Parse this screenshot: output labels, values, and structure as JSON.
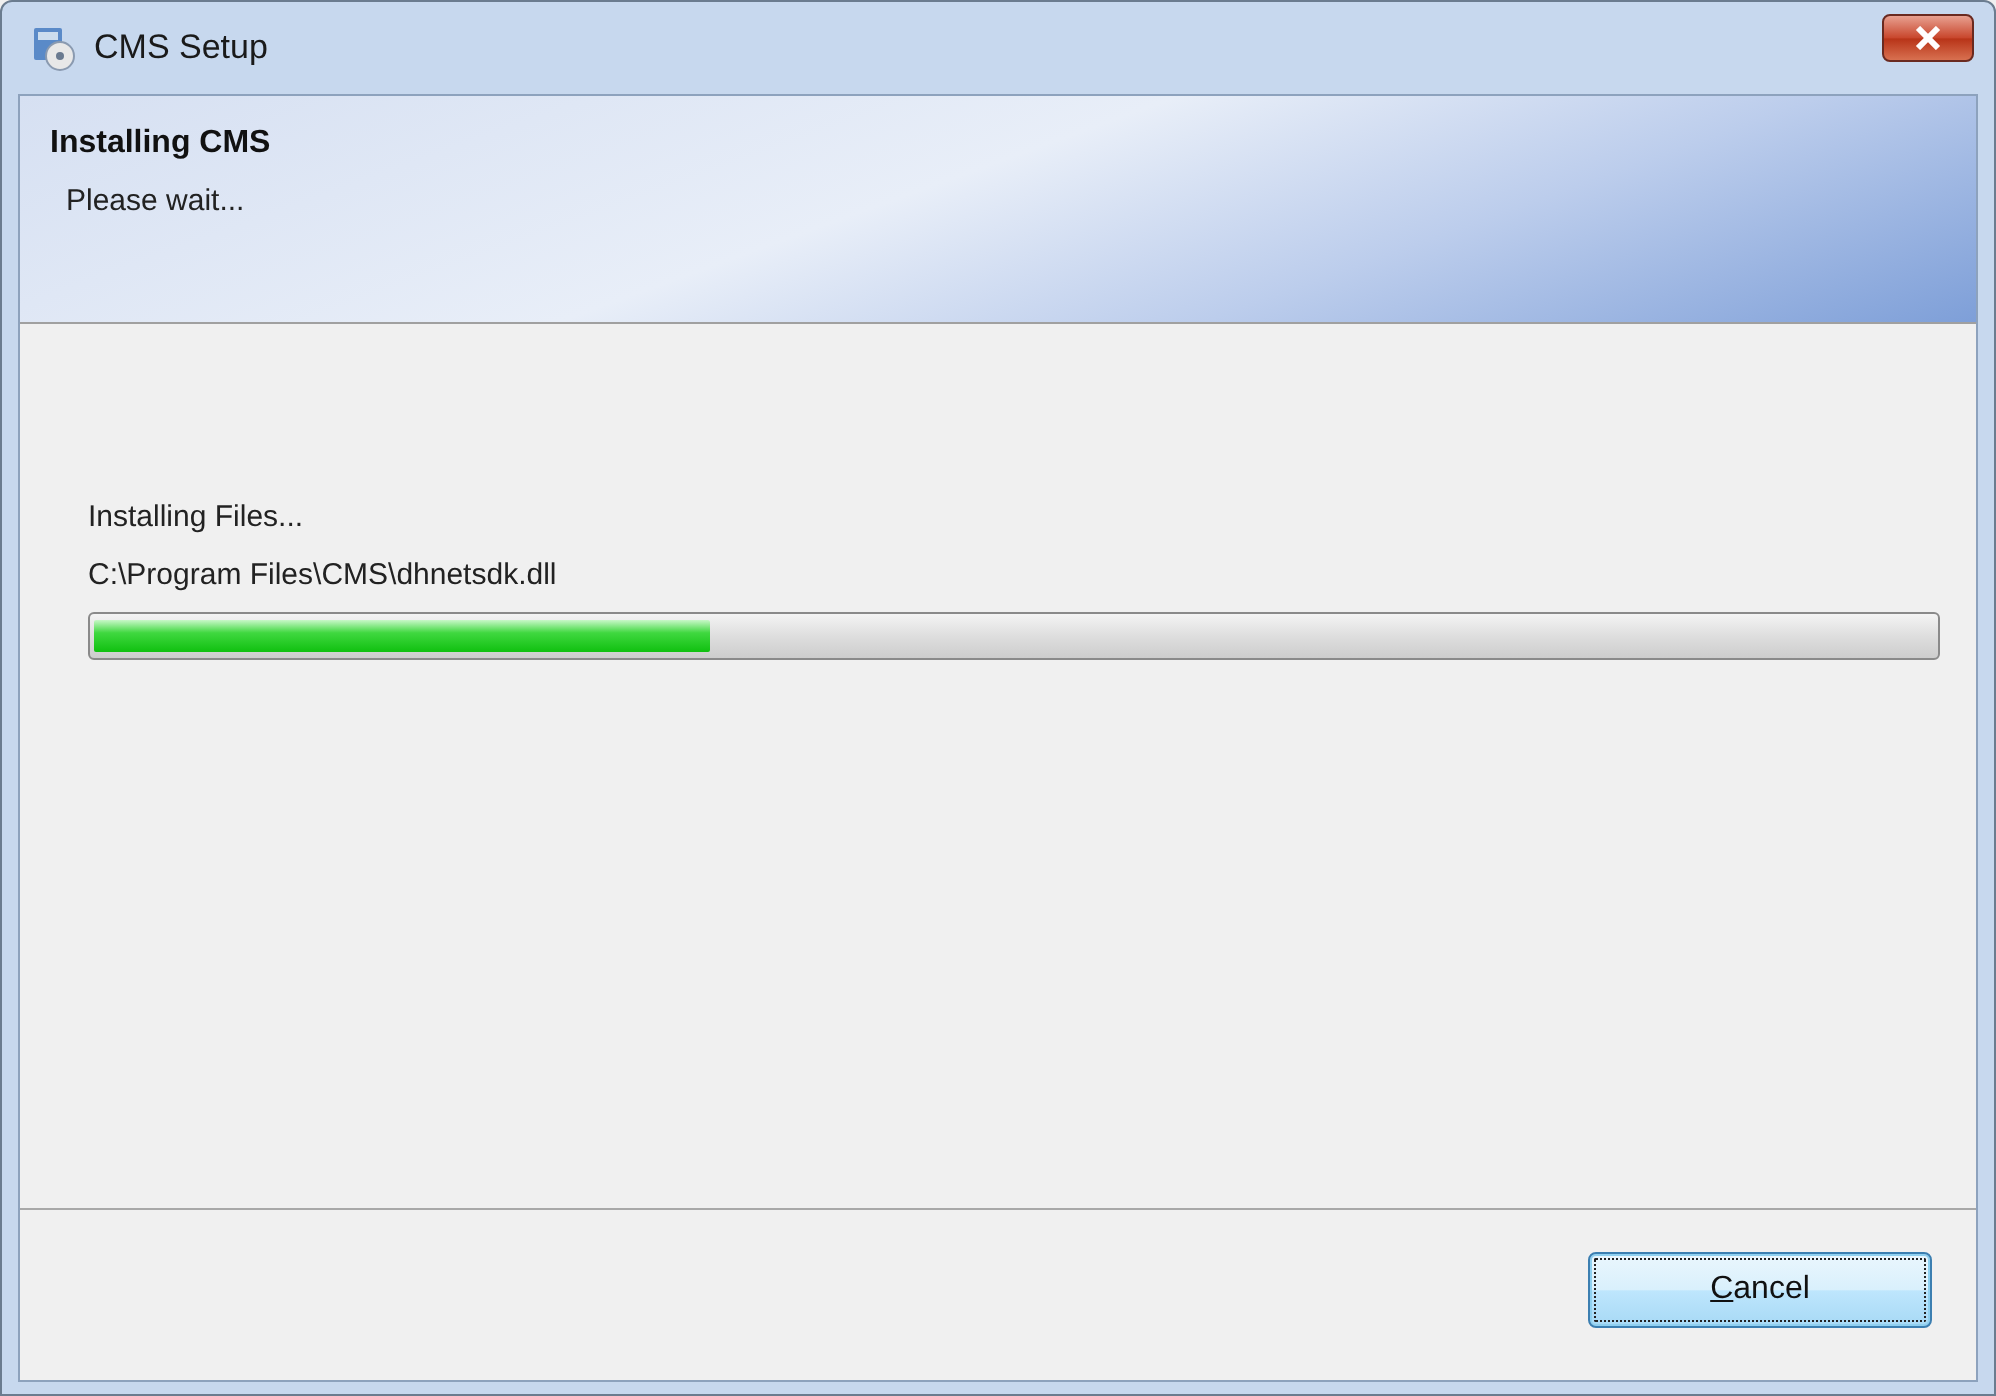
{
  "window": {
    "title": "CMS Setup"
  },
  "header": {
    "title": "Installing CMS",
    "subtitle": "Please wait..."
  },
  "status": {
    "action": "Installing Files...",
    "file": "C:\\Program Files\\CMS\\dhnetsdk.dll"
  },
  "progress": {
    "level": 0.335
  },
  "buttons": [
    {
      "label": "Cancel",
      "mnemonic_underlined": true,
      "focused": true
    }
  ]
}
